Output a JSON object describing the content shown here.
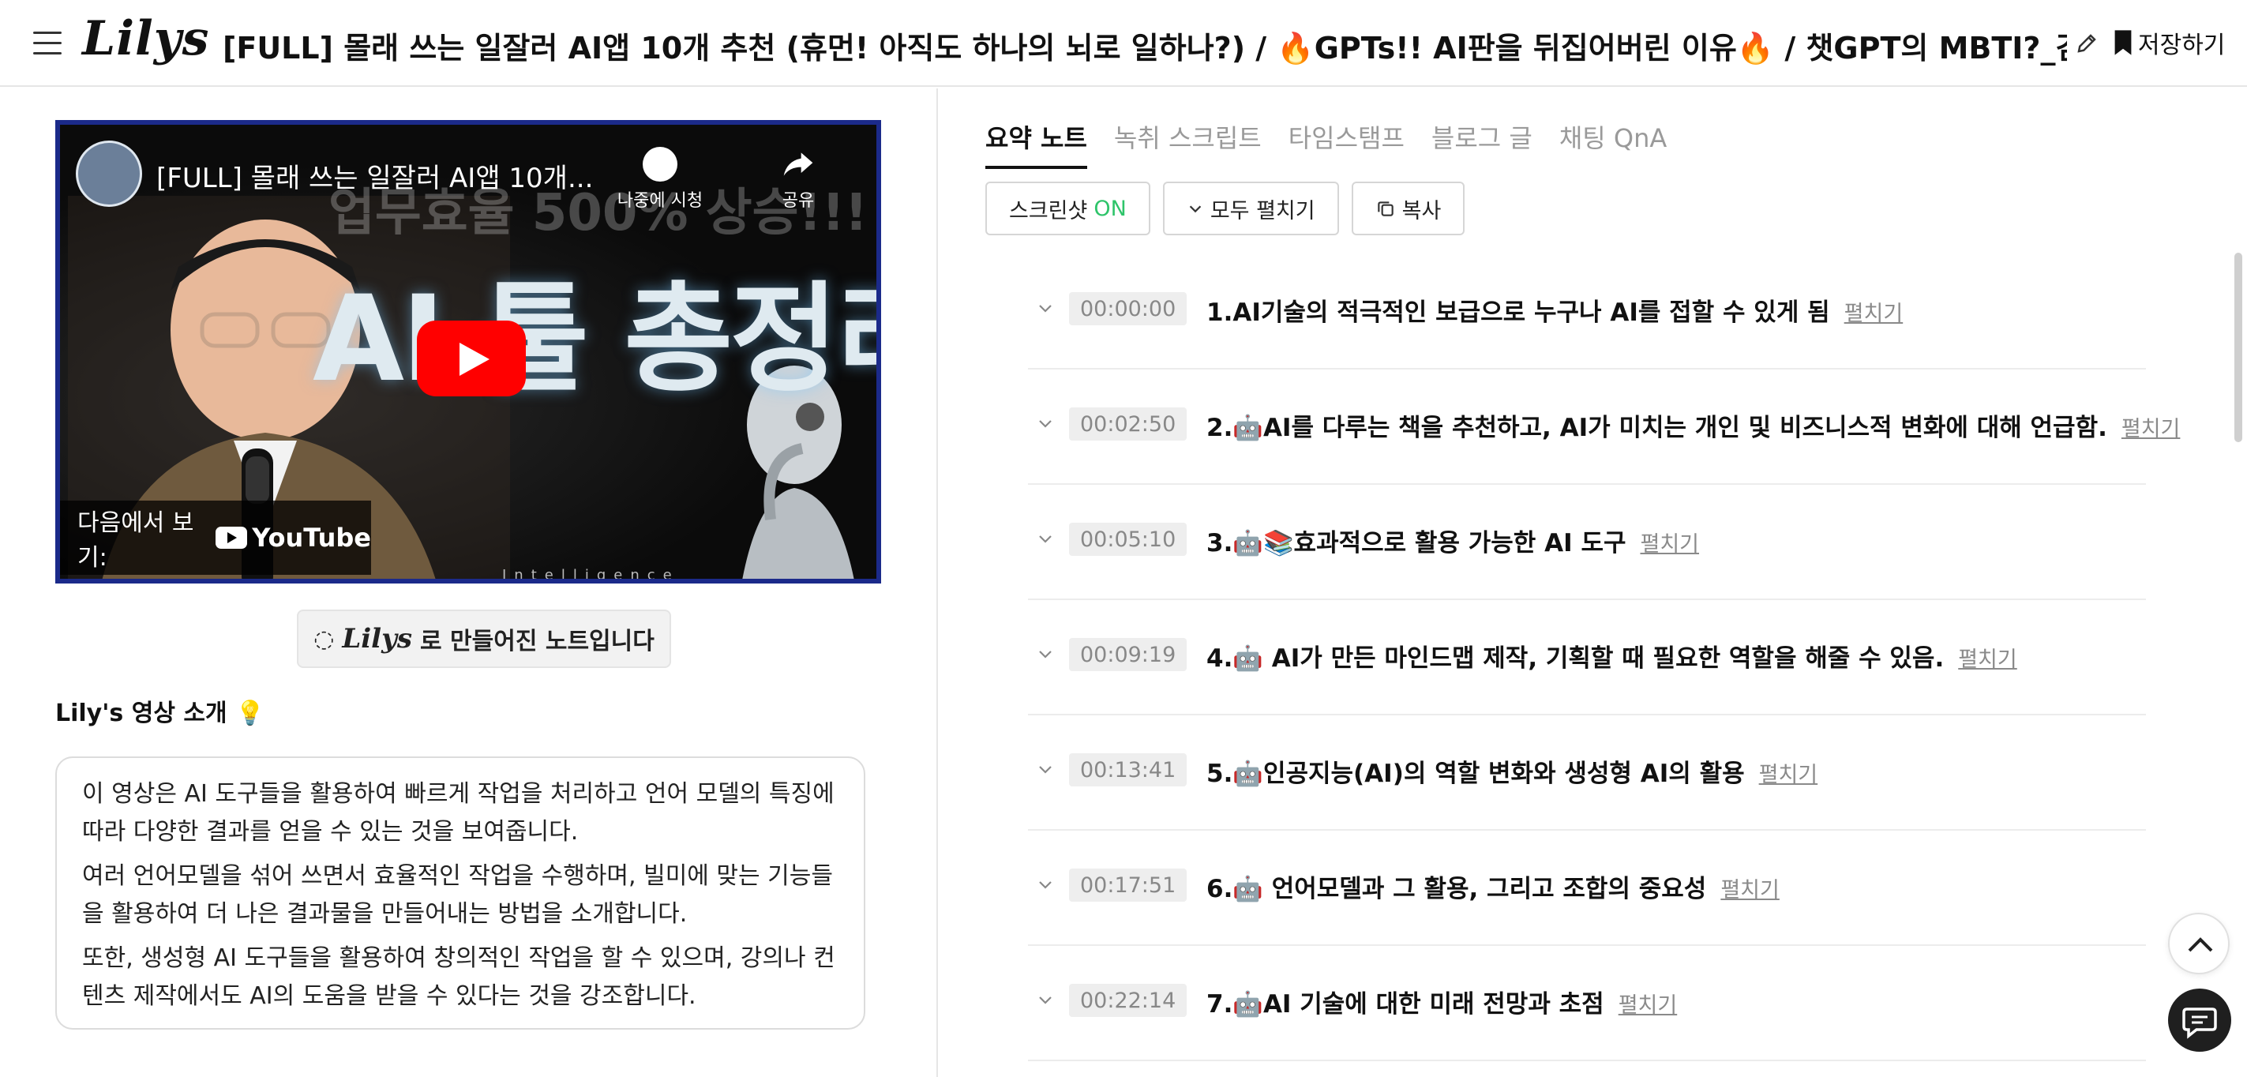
{
  "header": {
    "logo": "Lilys",
    "title": "[FULL] 몰래 쓰는 일잘러 AI앱 10개 추천 (휴먼! 아직도 하나의 뇌로 일하나?) / 🔥GPTs!! AI판을 뒤집어버린 이유🔥 / 챗GPT의 MBTI?_김덕진 소장",
    "save_label": "저장하기"
  },
  "video": {
    "title": "[FULL] 몰래 쓰는 일잘러 AI앱 10개...",
    "watch_later": "나중에 시청",
    "share": "공유",
    "thumbnail_top_text": "업무효율 500% 상승!!!",
    "thumbnail_main_text": "AI 툴 총정리",
    "thumbnail_caption": "Intelligence",
    "watch_on": "다음에서 보기:",
    "youtube": "YouTube"
  },
  "made_with": {
    "brand": "Lilys",
    "text": "로 만들어진 노트입니다"
  },
  "intro": {
    "heading": "Lily's 영상 소개 💡",
    "paragraphs": [
      "이 영상은 AI 도구들을 활용하여 빠르게 작업을 처리하고 언어 모델의 특징에 따라 다양한 결과를 얻을 수 있는 것을 보여줍니다.",
      "여러 언어모델을 섞어 쓰면서 효율적인 작업을 수행하며, 빌미에 맞는 기능들을 활용하여 더 나은 결과물을 만들어내는 방법을 소개합니다.",
      "또한, 생성형 AI 도구들을 활용하여 창의적인 작업을 할 수 있으며, 강의나 컨텐츠 제작에서도 AI의 도움을 받을 수 있다는 것을 강조합니다."
    ]
  },
  "tabs": [
    "요약 노트",
    "녹취 스크립트",
    "타임스탬프",
    "블로그 글",
    "채팅 QnA"
  ],
  "toolbar": {
    "screenshot_label": "스크린샷",
    "screenshot_state": "ON",
    "expand_all": "모두 펼치기",
    "copy": "복사"
  },
  "expand_label": "펼치기",
  "sections": [
    {
      "time": "00:00:00",
      "title": "1.AI기술의 적극적인 보급으로 누구나 AI를 접할 수 있게 됨"
    },
    {
      "time": "00:02:50",
      "title": "2.🤖AI를 다루는 책을 추천하고, AI가 미치는 개인 및 비즈니스적 변화에 대해 언급함."
    },
    {
      "time": "00:05:10",
      "title": "3.🤖📚효과적으로 활용 가능한 AI 도구"
    },
    {
      "time": "00:09:19",
      "title": "4.🤖 AI가 만든 마인드맵 제작, 기획할 때 필요한 역할을 해줄 수 있음."
    },
    {
      "time": "00:13:41",
      "title": "5.🤖인공지능(AI)의 역할 변화와 생성형 AI의 활용"
    },
    {
      "time": "00:17:51",
      "title": "6.🤖 언어모델과 그 활용, 그리고 조합의 중요성"
    },
    {
      "time": "00:22:14",
      "title": "7.🤖AI 기술에 대한 미래 전망과 초점"
    }
  ],
  "colors": {
    "accent_on": "#2ec46a",
    "youtube_red": "#ff0000",
    "video_border": "#1b2a8a"
  },
  "icons": [
    "menu-icon",
    "pencil-icon",
    "bookmark-icon",
    "chevron-down-icon",
    "copy-icon",
    "clock-icon",
    "share-icon",
    "play-icon",
    "chevron-up-icon",
    "chat-icon"
  ]
}
